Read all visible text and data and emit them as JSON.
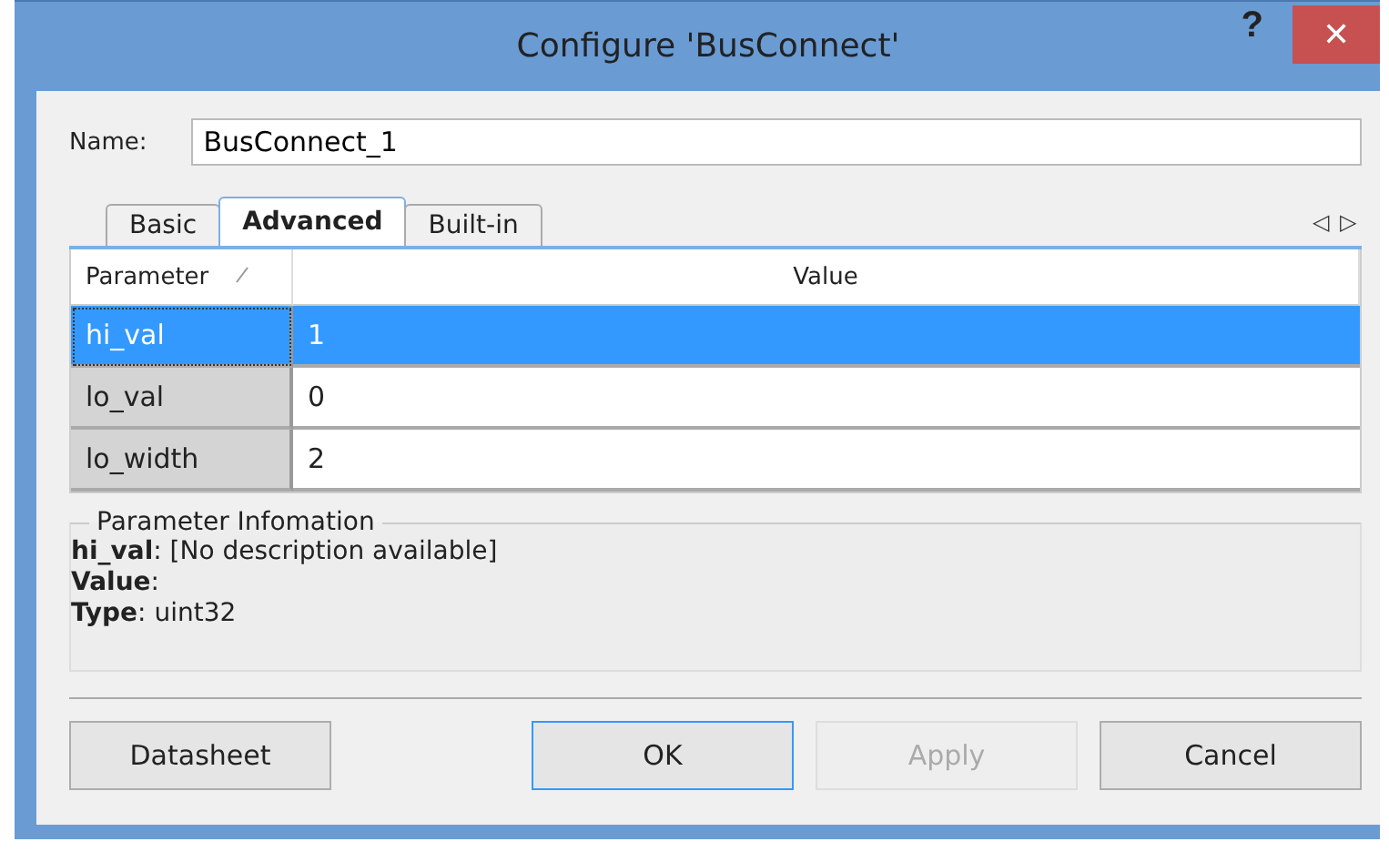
{
  "window": {
    "title": "Configure 'BusConnect'",
    "help": "?",
    "close": "✕"
  },
  "name_field": {
    "label": "Name:",
    "value": "BusConnect_1"
  },
  "tabs": [
    {
      "label": "Basic",
      "selected": false
    },
    {
      "label": "Advanced",
      "selected": true
    },
    {
      "label": "Built-in",
      "selected": false
    }
  ],
  "tab_scroll": [
    "◁",
    "▷"
  ],
  "table": {
    "columns": [
      "Parameter",
      "Value"
    ],
    "rows": [
      {
        "parameter": "hi_val",
        "value": "1",
        "selected": true
      },
      {
        "parameter": "lo_val",
        "value": "0",
        "selected": false
      },
      {
        "parameter": "lo_width",
        "value": "2",
        "selected": false
      }
    ]
  },
  "info": {
    "title": "Parameter Infomation",
    "lines": [
      "**hi_val**: [No description available]",
      "**Value**:",
      "**Type**: uint32"
    ]
  },
  "buttons": [
    {
      "label": "Datasheet",
      "disabled": false,
      "default": false
    },
    {
      "label": "OK",
      "disabled": false,
      "default": true
    },
    {
      "label": "Apply",
      "disabled": true,
      "default": false
    },
    {
      "label": "Cancel",
      "disabled": false,
      "default": false
    }
  ]
}
